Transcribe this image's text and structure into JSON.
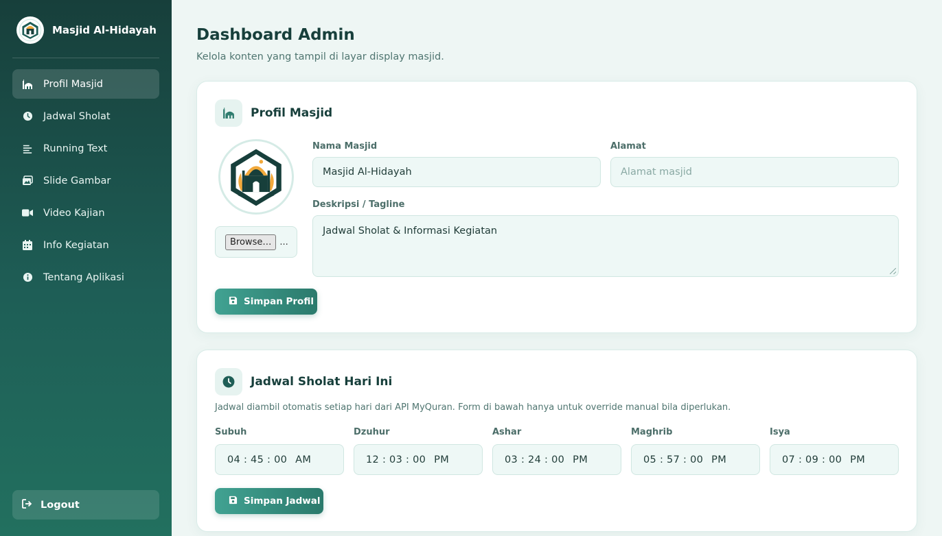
{
  "sidebar": {
    "brand": "Masjid Al-Hidayah",
    "items": [
      {
        "label": "Profil Masjid",
        "icon": "mosque-icon",
        "active": true
      },
      {
        "label": "Jadwal Sholat",
        "icon": "clock-icon"
      },
      {
        "label": "Running Text",
        "icon": "align-left-icon"
      },
      {
        "label": "Slide Gambar",
        "icon": "images-icon"
      },
      {
        "label": "Video Kajian",
        "icon": "video-icon"
      },
      {
        "label": "Info Kegiatan",
        "icon": "calendar-icon"
      },
      {
        "label": "Tentang Aplikasi",
        "icon": "info-icon"
      }
    ],
    "logout": "Logout"
  },
  "header": {
    "title": "Dashboard Admin",
    "subtitle": "Kelola konten yang tampil di layar display masjid."
  },
  "profil": {
    "title": "Profil Masjid",
    "nama_label": "Nama Masjid",
    "nama_value": "Masjid Al-Hidayah",
    "alamat_label": "Alamat",
    "alamat_placeholder": "Alamat masjid",
    "deskripsi_label": "Deskripsi / Tagline",
    "deskripsi_value": "Jadwal Sholat & Informasi Kegiatan",
    "browse_label": "Browse…",
    "file_name": "...",
    "save_label": "Simpan Profil"
  },
  "jadwal": {
    "title": "Jadwal Sholat Hari Ini",
    "note": "Jadwal diambil otomatis setiap hari dari API MyQuran. Form di bawah hanya untuk override manual bila diperlukan.",
    "times": [
      {
        "label": "Subuh",
        "time": "04 : 45 : 00",
        "ampm": "AM"
      },
      {
        "label": "Dzuhur",
        "time": "12 : 03 : 00",
        "ampm": "PM"
      },
      {
        "label": "Ashar",
        "time": "03 : 24 : 00",
        "ampm": "PM"
      },
      {
        "label": "Maghrib",
        "time": "05 : 57 : 00",
        "ampm": "PM"
      },
      {
        "label": "Isya",
        "time": "07 : 09 : 00",
        "ampm": "PM"
      }
    ],
    "save_label": "Simpan Jadwal"
  },
  "colors": {
    "sidebar_dark": "#173f3b",
    "accent": "#2b7a6c",
    "button_light": "#41a292",
    "page_bg": "#eef6f4"
  }
}
